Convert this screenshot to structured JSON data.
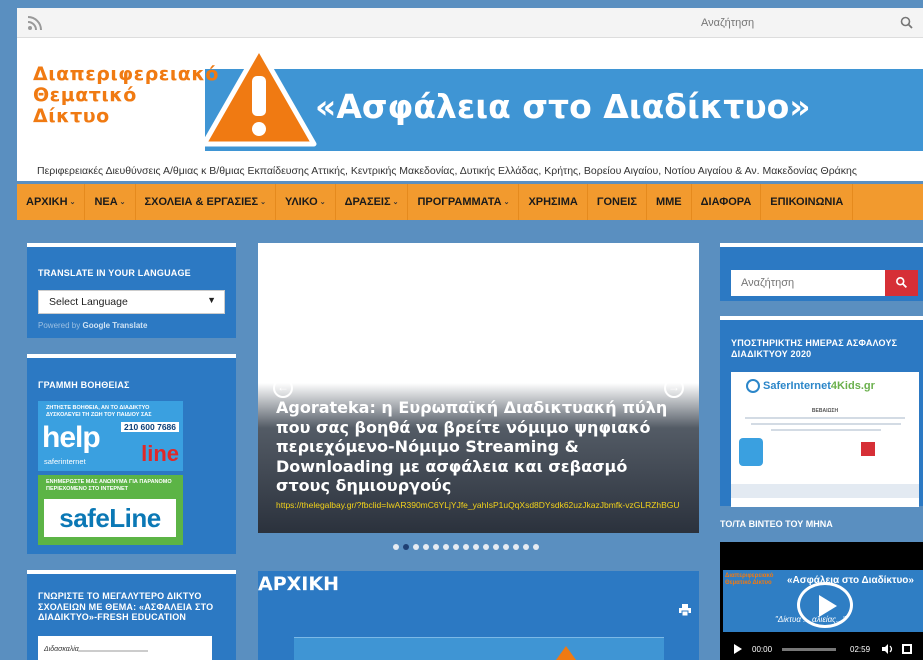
{
  "topbar": {
    "search_placeholder": "Αναζήτηση"
  },
  "header": {
    "logo_line1": "Διαπεριφερειακό",
    "logo_line2": "Θεματικό",
    "logo_line3": "Δίκτυο",
    "banner_title": "«Ασφάλεια στο Διαδίκτυο»",
    "subtitle": "Περιφερειακές Διευθύνσεις Α/θμιας κ Β/θμιας Εκπαίδευσης Αττικής, Κεντρικής Μακεδονίας, Δυτικής Ελλάδας, Κρήτης, Βορείου Αιγαίου, Νοτίου Αιγαίου & Αν. Μακεδονίας Θράκης"
  },
  "nav": {
    "items": [
      {
        "label": "ΑΡΧΙΚΗ",
        "dropdown": true
      },
      {
        "label": "ΝΕΑ",
        "dropdown": true
      },
      {
        "label": "ΣΧΟΛΕΙΑ & ΕΡΓΑΣΙΕΣ",
        "dropdown": true
      },
      {
        "label": "ΥΛΙΚΟ",
        "dropdown": true
      },
      {
        "label": "ΔΡΑΣΕΙΣ",
        "dropdown": true
      },
      {
        "label": "ΠΡΟΓΡΑΜΜΑΤΑ",
        "dropdown": true
      },
      {
        "label": "ΧΡΗΣΙΜΑ",
        "dropdown": false
      },
      {
        "label": "ΓΟΝΕΙΣ",
        "dropdown": false
      },
      {
        "label": "ΜΜΕ",
        "dropdown": false
      },
      {
        "label": "ΔΙΑΦΟΡΑ",
        "dropdown": false
      },
      {
        "label": "ΕΠΙΚΟΙΝΩΝΙΑ",
        "dropdown": false
      }
    ],
    "dropdown_mark": "⌄"
  },
  "left": {
    "translate": {
      "title": "TRANSLATE IN YOUR LANGUAGE",
      "select_value": "Select Language",
      "select_arrow": "▼",
      "powered_prefix": "Powered by",
      "powered_brand": "Google",
      "powered_suffix": "Translate"
    },
    "helpline": {
      "title": "ΓΡΑΜΜΗ ΒΟΗΘΕΙΑΣ",
      "small_text": "ΖΗΤΗΣΤΕ ΒΟΗΘΕΙΑ, ΑΝ ΤΟ ΔΙΑΔΙΚΤΥΟ ΔΥΣΚΟΛΕΥΕΙ ΤΗ ΖΩΗ ΤΟΥ ΠΑΙΔΙΟΥ ΣΑΣ",
      "help_word": "help",
      "phone": "210 600 7686",
      "line_word": "line",
      "saferinternet": "saferinternet",
      "safe_small": "ΕΝΗΜΕΡΩΣΤΕ ΜΑΣ ΑΝΩΝΥΜΑ ΓΙΑ ΠΑΡΑΝΟΜΟ ΠΕΡΙΕΧΟΜΕΝΟ ΣΤΟ ΙΝΤΕΡΝΕΤ",
      "safeline_word": "safeLine"
    },
    "network": {
      "title": "ΓΝΩΡΙΣΤΕ ΤΟ ΜΕΓΑΛΥΤΕΡΟ ΔΙΚΤΥΟ ΣΧΟΛΕΙΩΝ ΜΕ ΘΕΜΑ: «ΑΣΦΑΛΕΙΑ ΣΤΟ ΔΙΑΔΙΚΤΥΟ»-FRESH EDUCATION",
      "preview_text": "Διδασκαλία"
    }
  },
  "slider": {
    "title": "Agorateka: η Ευρωπαϊκή Διαδικτυακή πύλη που σας βοηθά να βρείτε νόμιμο ψηφιακό περιεχόμενο-Νόμιμο Streaming & Downloading με ασφάλεια και σεβασμό στους δημιουργούς",
    "link": "https://thelegalbay.gr/?fbclid=IwAR390mC6YLjYJfe_yahIsP1uQqXsd8DYsdk62uzJkazJbmfk-vzGLRZhBGU",
    "prev_label": "←",
    "next_label": "→",
    "dot_count": 15,
    "active_dot": 1
  },
  "main": {
    "title": "ΑΡΧΙΚΗ"
  },
  "right": {
    "search_placeholder": "Αναζήτηση",
    "day": {
      "title": "ΥΠΟΣΤΗΡΙΚΤΗΣ ΗΜΕΡΑΣ ΑΣΦΑΛΟΥΣ ΔΙΑΔΙΚΤΥΟΥ 2020",
      "logo_a": "SaferInternet",
      "logo_b": "4Kids.gr",
      "badge": "ΒΕΒΑΙΩΣΗ"
    },
    "video": {
      "title": "ΤΟ/ΤΑ ΒΙΝΤΕΟ ΤΟΥ ΜΗΝΑ",
      "thumb_left": "Διαπεριφερειακό Θεματικό Δίκτυο",
      "thumb_title": "«Ασφάλεια στο Διαδίκτυο»",
      "thumb_sub": "\"Δίκτυα ... αλιείας...\"",
      "current_time": "00:00",
      "duration": "02:59"
    }
  },
  "colors": {
    "page_bg": "#5a8fc0",
    "widget_bg": "#2c79c3",
    "nav_orange": "#f29a2e",
    "logo_orange": "#f07a12",
    "banner_blue": "#3f95d4",
    "link_yellow": "#f3d21a",
    "search_red": "#d62f36"
  }
}
